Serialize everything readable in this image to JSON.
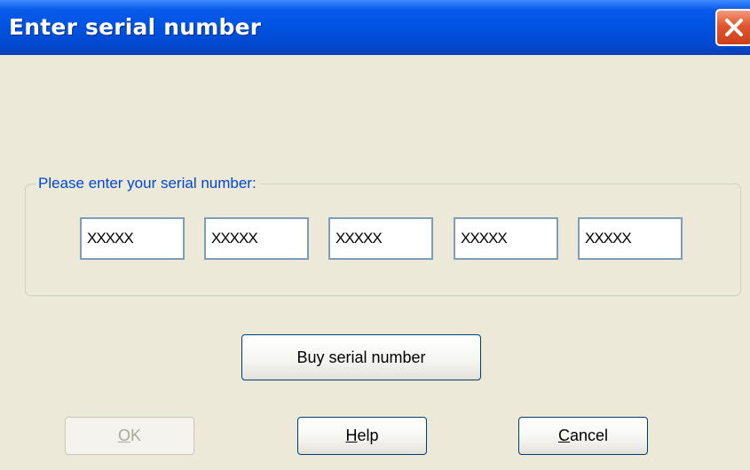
{
  "window": {
    "title": "Enter serial number"
  },
  "serial_group": {
    "label": "Please enter your serial number:",
    "fields": [
      {
        "value": "XXXXX"
      },
      {
        "value": "XXXXX"
      },
      {
        "value": "XXXXX"
      },
      {
        "value": "XXXXX"
      },
      {
        "value": "XXXXX"
      }
    ]
  },
  "buttons": {
    "buy": "Buy serial number",
    "ok": {
      "mnemonic": "O",
      "rest": "K",
      "enabled": false
    },
    "help": {
      "mnemonic": "H",
      "rest": "elp"
    },
    "cancel": {
      "mnemonic": "C",
      "rest": "ancel"
    }
  },
  "icons": {
    "close": "close-icon"
  },
  "colors": {
    "titlebar": "#0054e3",
    "window_bg": "#ece9d8",
    "close": "#e0562e",
    "group_label": "#0046d5"
  }
}
